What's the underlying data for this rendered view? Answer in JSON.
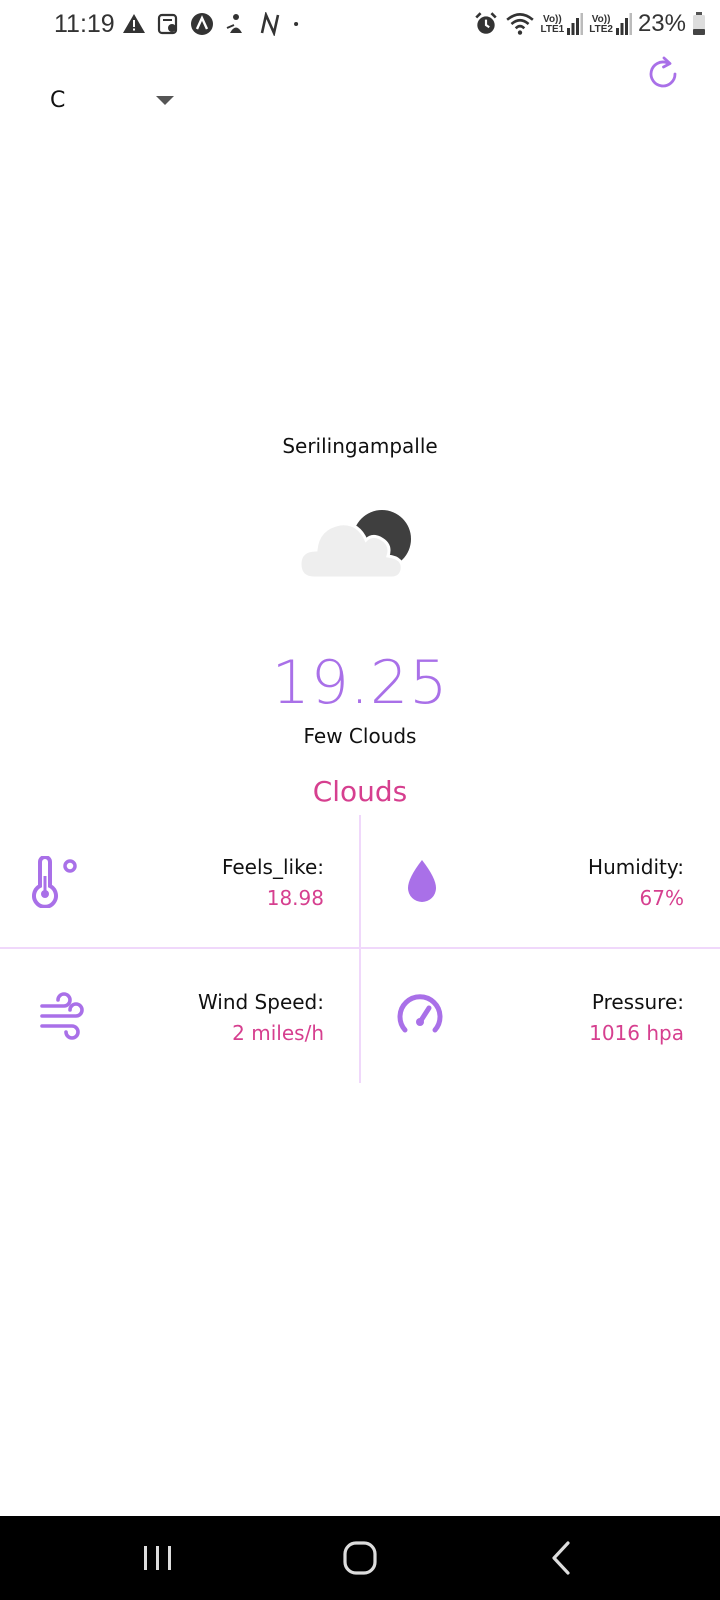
{
  "status_bar": {
    "time": "11:19",
    "battery": "23%",
    "sim1_label": "LTE1",
    "sim2_label": "LTE2",
    "volte": "Vo))"
  },
  "toolbar": {
    "unit_selected": "C",
    "refresh_icon": "refresh-icon"
  },
  "weather": {
    "location": "Serilingampalle",
    "icon": "few-clouds-night-icon",
    "temperature": "19.25",
    "description": "Few Clouds",
    "main": "Clouds"
  },
  "details": {
    "feels_like_label": "Feels_like:",
    "feels_like_value": "18.98",
    "humidity_label": "Humidity:",
    "humidity_value": "67%",
    "wind_label": "Wind Speed:",
    "wind_value": "2 miles/h",
    "pressure_label": "Pressure:",
    "pressure_value": "1016 hpa"
  },
  "colors": {
    "accent": "#a970e8",
    "highlight": "#d63f8f",
    "divider": "#f0d8fb"
  }
}
